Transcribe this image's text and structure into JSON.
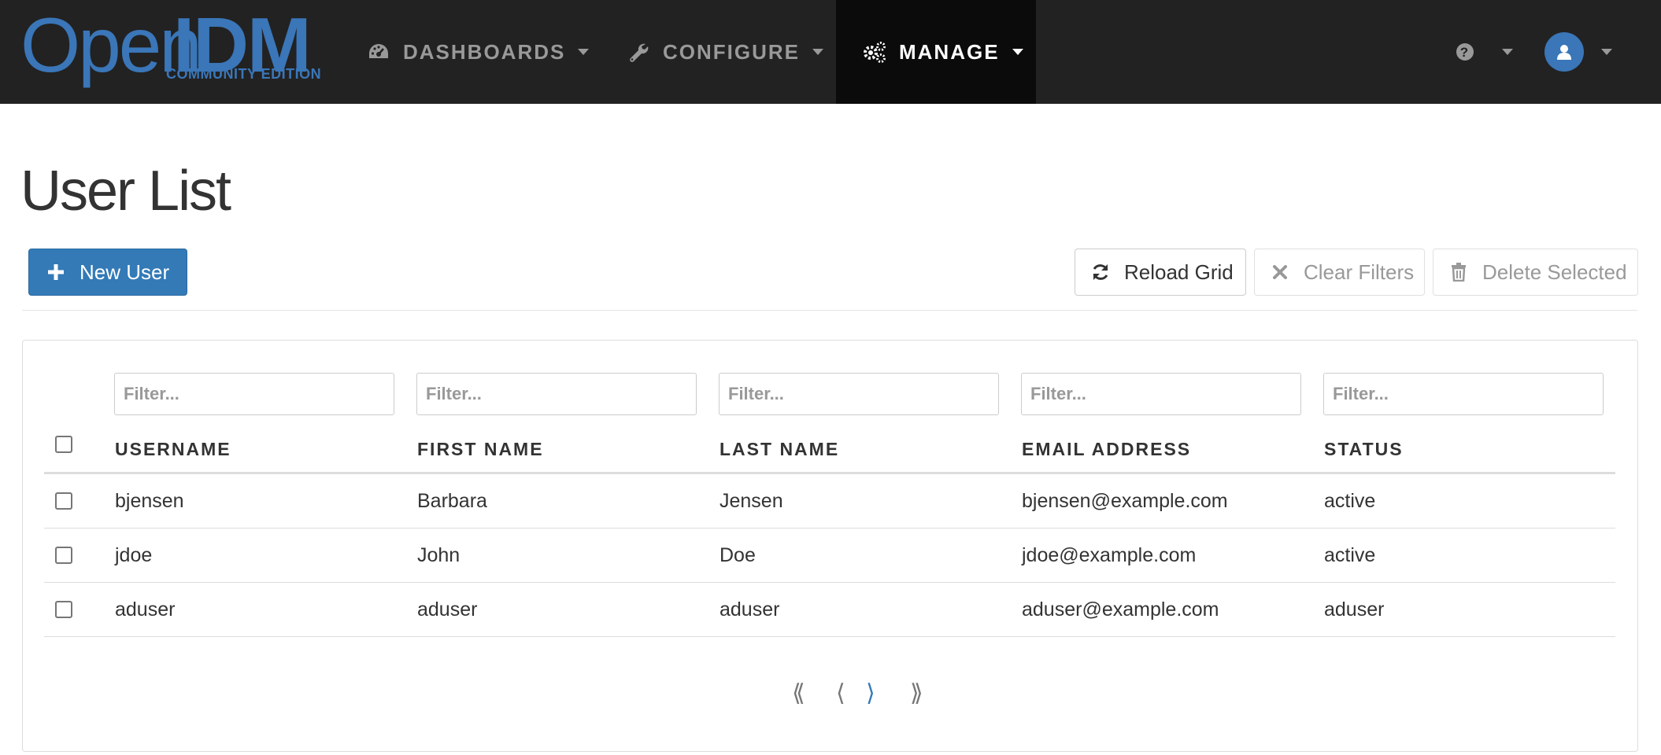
{
  "logo": {
    "open": "Open",
    "idm": "IDM",
    "edition": "COMMUNITY EDITION"
  },
  "nav": {
    "dashboards": "DASHBOARDS",
    "configure": "CONFIGURE",
    "manage": "MANAGE"
  },
  "page": {
    "title": "User List"
  },
  "toolbar": {
    "new_user": "New User",
    "reload": "Reload Grid",
    "clear": "Clear Filters",
    "delete": "Delete Selected"
  },
  "filters": {
    "placeholder": "Filter..."
  },
  "columns": [
    "USERNAME",
    "FIRST NAME",
    "LAST NAME",
    "EMAIL ADDRESS",
    "STATUS"
  ],
  "rows": [
    [
      "bjensen",
      "Barbara",
      "Jensen",
      "bjensen@example.com",
      "active"
    ],
    [
      "jdoe",
      "John",
      "Doe",
      "jdoe@example.com",
      "active"
    ],
    [
      "aduser",
      "aduser",
      "aduser",
      "aduser@example.com",
      "aduser"
    ]
  ],
  "pagination": {
    "first": "⟪",
    "prev": "⟨",
    "next": "⟩",
    "last": "⟫"
  },
  "colors": {
    "navbar": "#222222",
    "brand": "#3a76b8",
    "primary": "#337ab7",
    "active_nav": "#0b0b0b"
  },
  "icons": {
    "dashboards": "dashboard-gauge-icon",
    "configure": "wrench-icon",
    "manage": "cogs-icon",
    "help": "question-circle-icon",
    "user": "user-avatar-icon"
  }
}
